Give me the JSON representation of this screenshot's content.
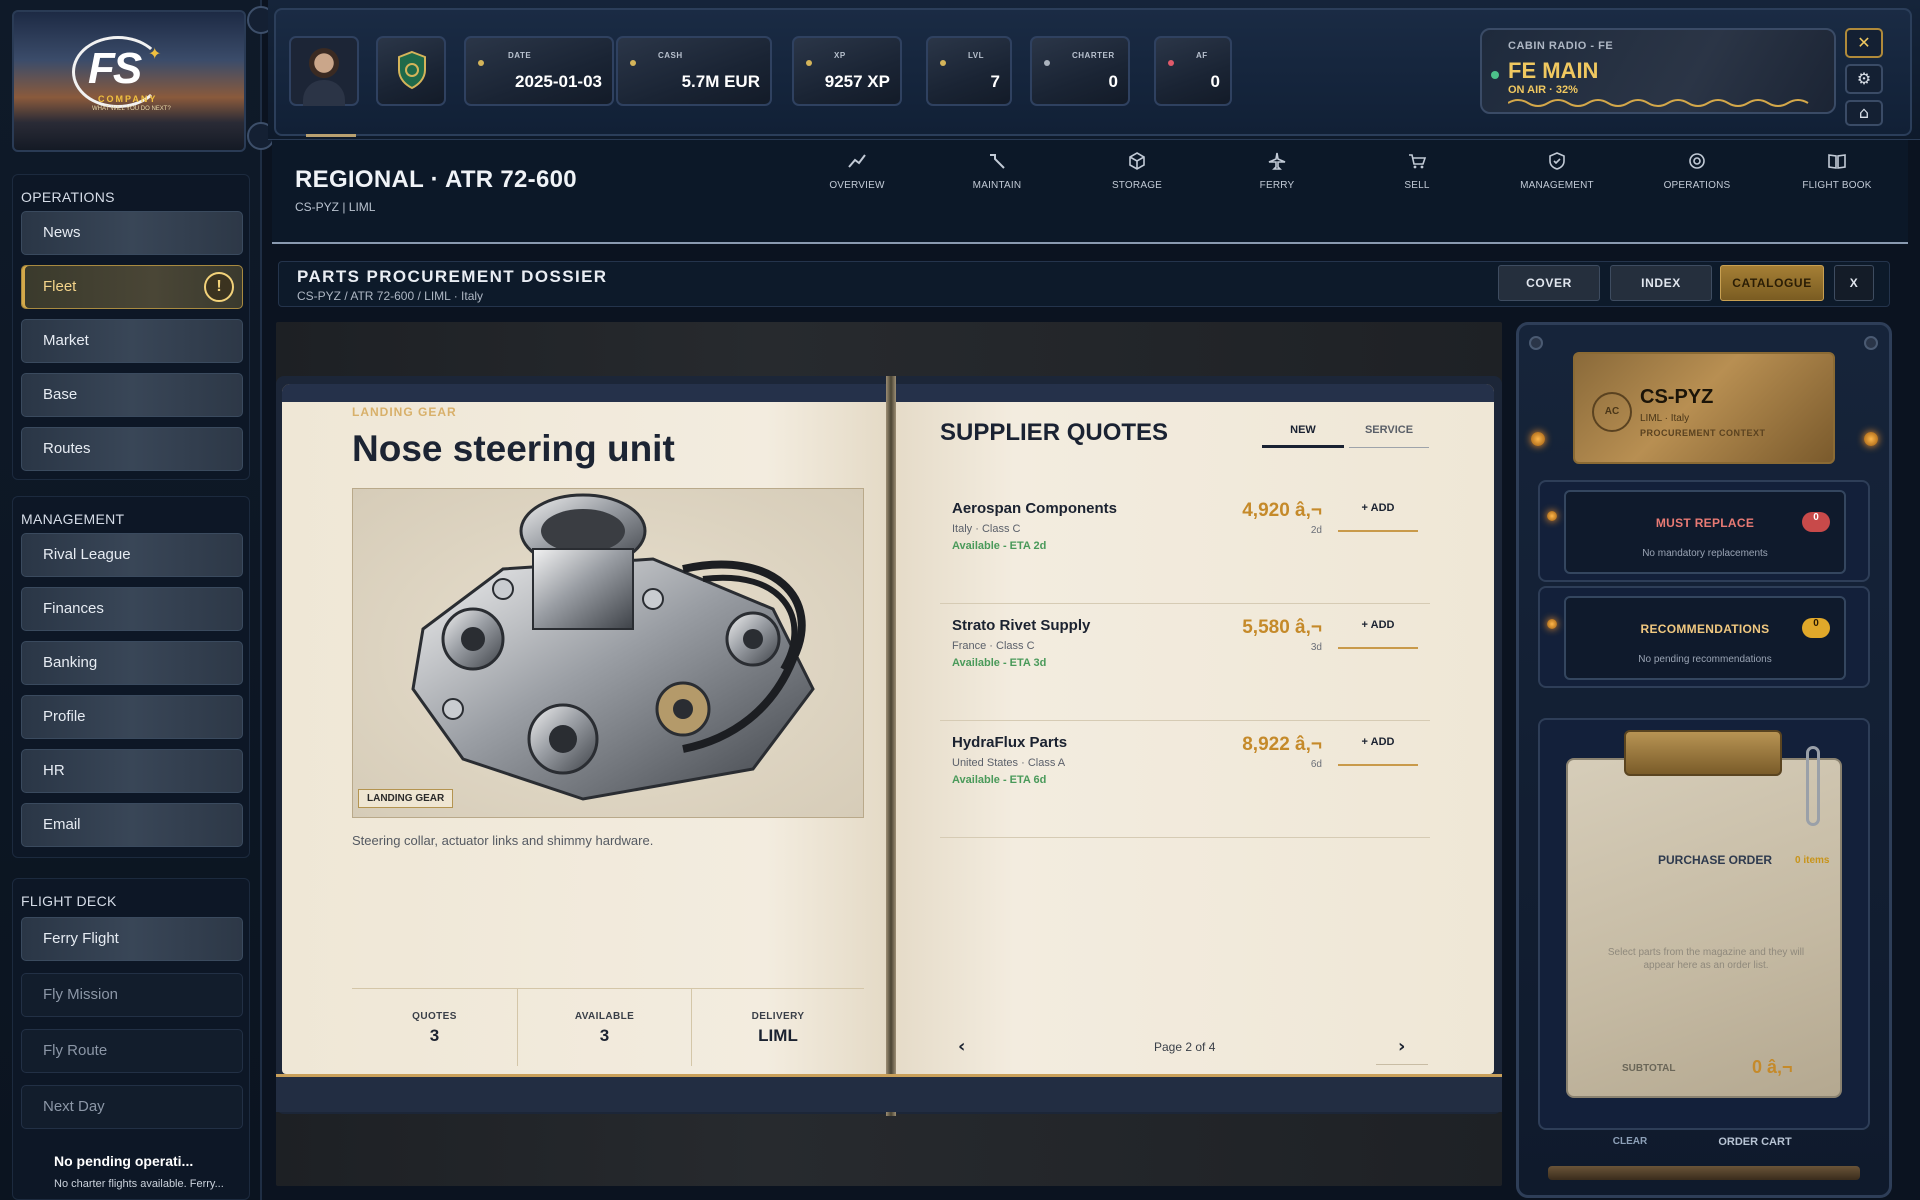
{
  "brand": {
    "logo_text": "FS",
    "logo_sub": "COMPANY",
    "logo_tag": "WHAT WILL YOU DO NEXT?"
  },
  "sidebar": {
    "groups": [
      {
        "title": "OPERATIONS",
        "items": [
          {
            "label": "News"
          },
          {
            "label": "Fleet"
          },
          {
            "label": "Market"
          },
          {
            "label": "Base"
          },
          {
            "label": "Routes"
          }
        ]
      },
      {
        "title": "MANAGEMENT",
        "items": [
          {
            "label": "Rival League"
          },
          {
            "label": "Finances"
          },
          {
            "label": "Banking"
          },
          {
            "label": "Profile"
          },
          {
            "label": "HR"
          },
          {
            "label": "Email"
          }
        ]
      },
      {
        "title": "FLIGHT DECK",
        "items": [
          {
            "label": "Ferry Flight"
          },
          {
            "label": "Fly Mission"
          },
          {
            "label": "Fly Route"
          },
          {
            "label": "Next Day"
          }
        ]
      }
    ],
    "fleet_alert": "!",
    "pending": {
      "title": "No pending operati...",
      "subtitle": "No charter flights available. Ferry..."
    }
  },
  "topbar": {
    "cards": [
      {
        "label": "DATE",
        "value": "2025-01-03"
      },
      {
        "label": "CASH",
        "value": "5.7M EUR"
      },
      {
        "label": "XP",
        "value": "9257 XP"
      },
      {
        "label": "LVL",
        "value": "7"
      },
      {
        "label": "CHARTER",
        "value": "0"
      },
      {
        "label": "AF",
        "value": "0"
      }
    ],
    "radio": {
      "label": "CABIN RADIO - FE",
      "title": "FE MAIN",
      "status": "ON AIR  ·  32%"
    },
    "window_buttons": {
      "close": "✕",
      "settings": "⚙",
      "profile": "⌂"
    }
  },
  "aircraft": {
    "title": "REGIONAL · ATR 72-600",
    "subtitle": "CS-PYZ   |   LIML"
  },
  "tabs": [
    {
      "label": "OVERVIEW",
      "icon": "chart-line-icon"
    },
    {
      "label": "MAINTAIN",
      "icon": "wrench-icon"
    },
    {
      "label": "STORAGE",
      "icon": "box-icon"
    },
    {
      "label": "FERRY",
      "icon": "plane-icon"
    },
    {
      "label": "SELL",
      "icon": "cart-icon"
    },
    {
      "label": "MANAGEMENT",
      "icon": "shield-check-icon"
    },
    {
      "label": "OPERATIONS",
      "icon": "target-icon"
    },
    {
      "label": "FLIGHT BOOK",
      "icon": "book-icon"
    }
  ],
  "dossier": {
    "title": "PARTS PROCUREMENT DOSSIER",
    "breadcrumb": "CS-PYZ  /  ATR 72-600  /  LIML · Italy",
    "buttons": {
      "cover": "COVER",
      "index": "INDEX",
      "catalogue": "CATALOGUE",
      "close": "X"
    }
  },
  "part": {
    "category": "LANDING GEAR",
    "name": "Nose steering unit",
    "image_tag": "LANDING GEAR",
    "description": "Steering collar, actuator links and shimmy hardware.",
    "stats": [
      {
        "label": "QUOTES",
        "value": "3"
      },
      {
        "label": "AVAILABLE",
        "value": "3"
      },
      {
        "label": "DELIVERY",
        "value": "LIML"
      }
    ]
  },
  "quotes": {
    "title": "SUPPLIER QUOTES",
    "tab_new": "NEW",
    "tab_service": "SERVICE",
    "items": [
      {
        "name": "Aerospan Components",
        "origin": "Italy · Class C",
        "availability": "Available - ETA 2d",
        "price": "4,920 â‚¬",
        "days": "2d",
        "add": "+ ADD"
      },
      {
        "name": "Strato Rivet Supply",
        "origin": "France · Class C",
        "availability": "Available - ETA 3d",
        "price": "5,580 â‚¬",
        "days": "3d",
        "add": "+ ADD"
      },
      {
        "name": "HydraFlux Parts",
        "origin": "United States · Class A",
        "availability": "Available - ETA 6d",
        "price": "8,922 â‚¬",
        "days": "6d",
        "add": "+ ADD"
      }
    ],
    "pager": {
      "prev": "‹",
      "next": "›",
      "label": "Page 2 of 4"
    }
  },
  "right_panel": {
    "plate": {
      "badge": "AC",
      "registration": "CS-PYZ",
      "location": "LIML · Italy",
      "subtitle": "PROCUREMENT CONTEXT"
    },
    "must_replace": {
      "title": "MUST REPLACE",
      "count": "0",
      "subtitle": "No mandatory replacements"
    },
    "recommendations": {
      "title": "RECOMMENDATIONS",
      "count": "0",
      "subtitle": "No pending recommendations"
    },
    "purchase_order": {
      "title": "PURCHASE ORDER",
      "count": "0 items",
      "empty": "Select parts from the magazine and they will appear here as an order list.",
      "subtotal_label": "SUBTOTAL",
      "subtotal_value": "0 â‚¬",
      "clear": "CLEAR",
      "order": "ORDER CART"
    }
  },
  "colors": {
    "accent_gold": "#c58a2a",
    "panel_navy": "#0d1726",
    "available_green": "#4a9a5a",
    "alert_red": "#c84a4a"
  }
}
